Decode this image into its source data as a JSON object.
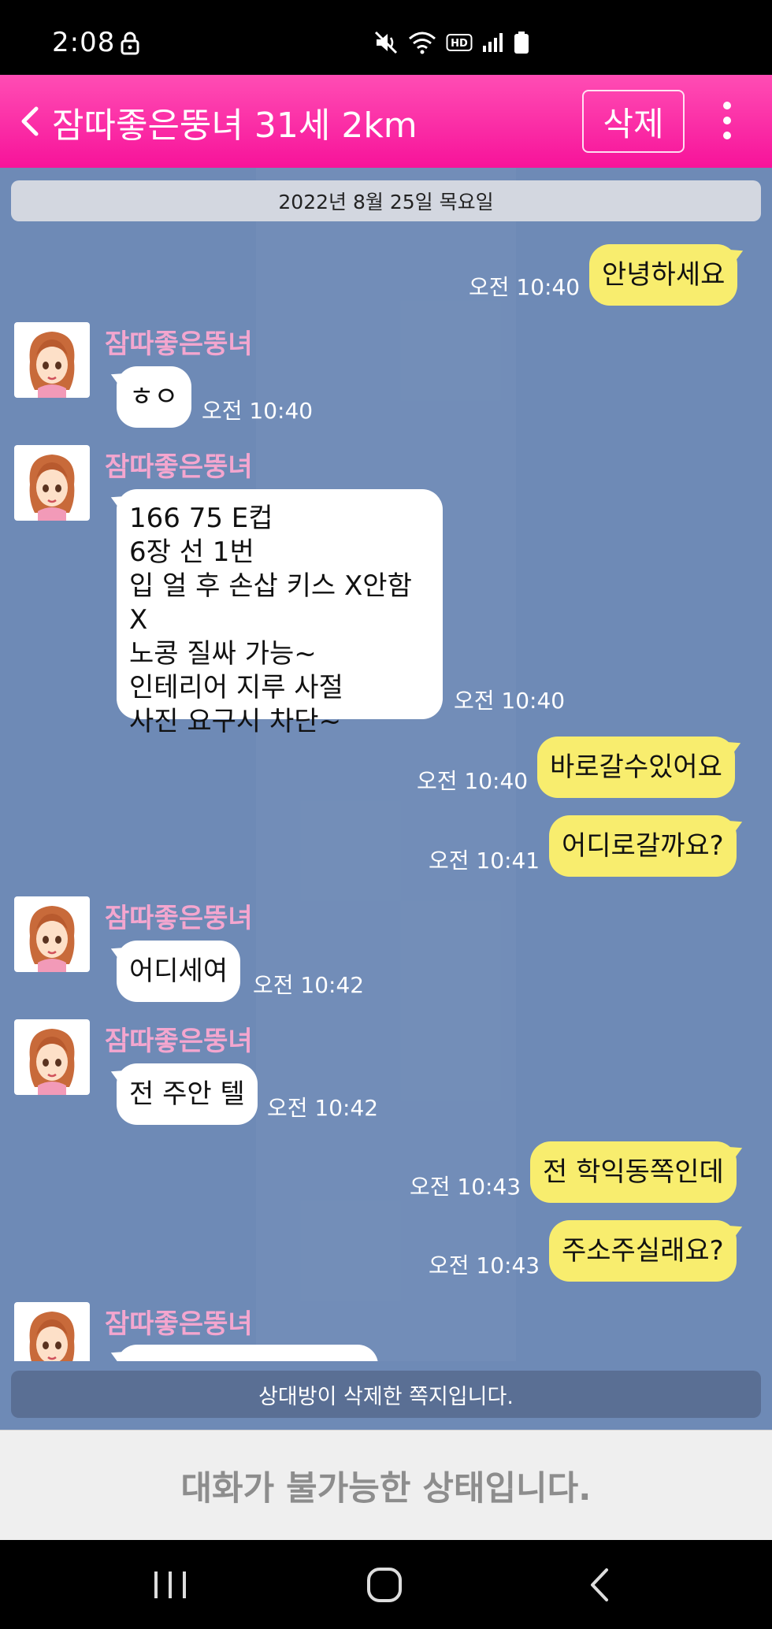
{
  "status_bar": {
    "time": "2:08",
    "icons": [
      "lock-icon",
      "mute-icon",
      "wifi-icon",
      "hd-icon",
      "signal-icon",
      "battery-icon"
    ],
    "hd_label": "HD"
  },
  "header": {
    "title": "잠따좋은뚱녀 31세 2km",
    "delete_label": "삭제",
    "accent_color": "#f7139a"
  },
  "chat": {
    "date": "2022년 8월 25일 목요일",
    "sender_name": "잠따좋은뚱녀",
    "messages": [
      {
        "from": "me",
        "text": "안녕하세요",
        "time": "오전 10:40"
      },
      {
        "from": "other",
        "text": "ㅎㅇ",
        "time": "오전 10:40"
      },
      {
        "from": "other",
        "text": "166  75  E컵\n6장 선 1번\n입 얼 후 손삽 키스 X안함X\n노콩 질싸 가능~\n인테리어  지루 사절\n사진 요구시 차단~",
        "time": "오전 10:40"
      },
      {
        "from": "me",
        "text": "바로갈수있어요",
        "time": "오전 10:40"
      },
      {
        "from": "me",
        "text": "어디로갈까요?",
        "time": "오전 10:41"
      },
      {
        "from": "other",
        "text": "어디세여",
        "time": "오전 10:42"
      },
      {
        "from": "other",
        "text": "전 주안 텔",
        "time": "오전 10:42"
      },
      {
        "from": "me",
        "text": "전 학익동쪽인데",
        "time": "오전 10:43"
      },
      {
        "from": "me",
        "text": "주소주실래요?",
        "time": "오전 10:43"
      }
    ],
    "colors": {
      "background": "#6e8ab6",
      "my_bubble": "#f8ed6e",
      "their_bubble": "#ffffff",
      "sender_name": "#f4a6cf"
    }
  },
  "deleted_notice": "상대방이 삭제한 쪽지입니다.",
  "input_disabled_text": "대화가 불가능한 상태입니다.",
  "nav": {
    "icons": [
      "recent-apps-icon",
      "home-icon",
      "back-icon"
    ]
  }
}
